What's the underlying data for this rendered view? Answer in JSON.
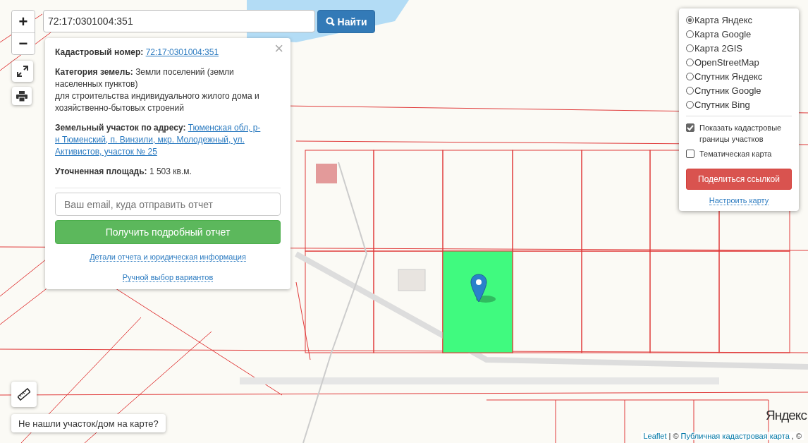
{
  "search": {
    "value": "72:17:0301004:351",
    "button": "Найти"
  },
  "zoom_controls": [
    {
      "label": "+"
    },
    {
      "label": "−"
    }
  ],
  "popup": {
    "close": "×",
    "fields": [
      {
        "kind": "link",
        "label": "Кадастровый номер:",
        "value": [
          "72:17:0301004:351"
        ]
      },
      {
        "kind": "text",
        "label": "Категория земель:",
        "value": [
          "Земли поселений (земли населенных пунктов)",
          "для строительства индивидуального жилого дома и хозяйственно-бытовых строений"
        ]
      },
      {
        "kind": "link",
        "label": "Земельный участок по адресу:",
        "value": [
          "Тюменская обл, р-н Тюменский, п. Винзили, мкр. Молодежный, ул. Активистов, участок № 25"
        ]
      },
      {
        "kind": "text",
        "label": "Уточненная площадь:",
        "value": [
          "1 503 кв.м."
        ]
      }
    ],
    "email_placeholder": "Ваш email, куда отправить отчет",
    "submit_button": "Получить подробный отчет",
    "links": [
      "Детали отчета и юридическая информация",
      "Ручной выбор вариантов"
    ]
  },
  "layers": [
    {
      "label": "Карта Яндекс",
      "selected": true
    },
    {
      "label": "Карта Google",
      "selected": false
    },
    {
      "label": "Карта 2GIS",
      "selected": false
    },
    {
      "label": "OpenStreetMap",
      "selected": false
    },
    {
      "label": "Спутник Яндекс",
      "selected": false
    },
    {
      "label": "Спутник Google",
      "selected": false
    },
    {
      "label": "Спутник Bing",
      "selected": false
    }
  ],
  "options": [
    {
      "label": "Показать кадастровые границы участков",
      "checked": true
    },
    {
      "label": "Тематическая карта",
      "checked": false
    }
  ],
  "share_button": "Поделиться ссылкой",
  "settings_link": "Настроить карту",
  "not_found_button": "Не нашли участок/дом на карте?",
  "map_logo": "Яндекс",
  "attribution": {
    "leaflet": "Leaflet",
    "separator": "|",
    "copyright": "©",
    "cadastral": "Публичная кадастровая карта",
    "tail": ", ©"
  }
}
